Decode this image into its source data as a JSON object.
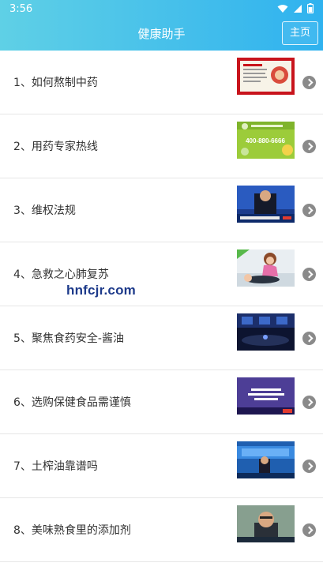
{
  "status_bar": {
    "time": "3:56"
  },
  "app_bar": {
    "title": "健康助手",
    "home_label": "主页"
  },
  "list": [
    {
      "label": "1、如何熬制中药",
      "thumb": "chinese-medicine-thumb"
    },
    {
      "label": "2、用药专家热线",
      "thumb": "hotline-thumb",
      "thumb_text": "400-880-6666"
    },
    {
      "label": "3、维权法规",
      "thumb": "news-anchor-thumb"
    },
    {
      "label": "4、急救之心肺复苏",
      "thumb": "cpr-cartoon-thumb"
    },
    {
      "label": "5、聚焦食药安全-酱油",
      "thumb": "studio-thumb"
    },
    {
      "label": "6、选购保健食品需谨慎",
      "thumb": "health-food-thumb"
    },
    {
      "label": "7、土榨油靠谱吗",
      "thumb": "oil-report-thumb"
    },
    {
      "label": "8、美味熟食里的添加剂",
      "thumb": "interview-thumb"
    }
  ],
  "watermark": "hnfcjr.com",
  "colors": {
    "appbar_start": "#5fd0e6",
    "appbar_end": "#2fb2ef",
    "arrow": "#8a8a8a"
  }
}
